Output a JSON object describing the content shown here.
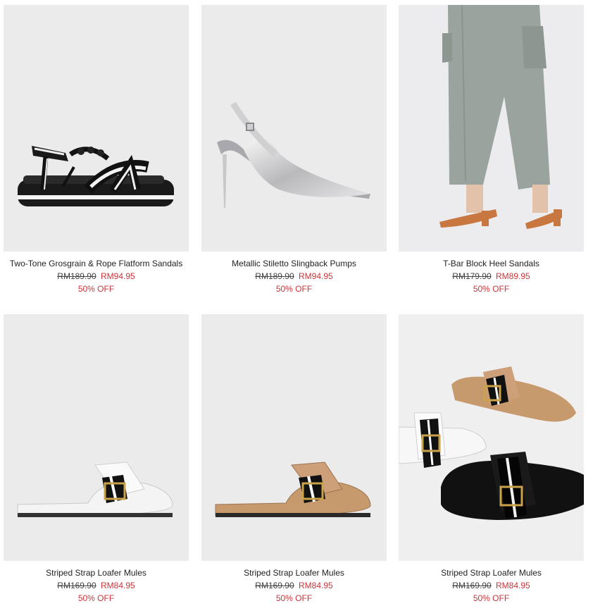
{
  "theme": {
    "sale_color": "#c8353a",
    "image_bg": "#ebebec"
  },
  "products": [
    {
      "name": "Two-Tone Grosgrain & Rope Flatform Sandals",
      "old_price": "RM189.90",
      "new_price": "RM94.95",
      "discount": "50% OFF",
      "image": "black-white-flatform-sandal"
    },
    {
      "name": "Metallic Stiletto Slingback Pumps",
      "old_price": "RM189.90",
      "new_price": "RM94.95",
      "discount": "50% OFF",
      "image": "silver-slingback-pump"
    },
    {
      "name": "T-Bar Block Heel Sandals",
      "old_price": "RM179.90",
      "new_price": "RM89.95",
      "discount": "50% OFF",
      "image": "model-wearing-tan-block-heel-sandals"
    },
    {
      "name": "Striped Strap Loafer Mules",
      "old_price": "RM169.90",
      "new_price": "RM84.95",
      "discount": "50% OFF",
      "image": "white-loafer-mule"
    },
    {
      "name": "Striped Strap Loafer Mules",
      "old_price": "RM169.90",
      "new_price": "RM84.95",
      "discount": "50% OFF",
      "image": "tan-loafer-mule"
    },
    {
      "name": "Striped Strap Loafer Mules",
      "old_price": "RM169.90",
      "new_price": "RM84.95",
      "discount": "50% OFF",
      "image": "three-loafer-mules"
    }
  ]
}
